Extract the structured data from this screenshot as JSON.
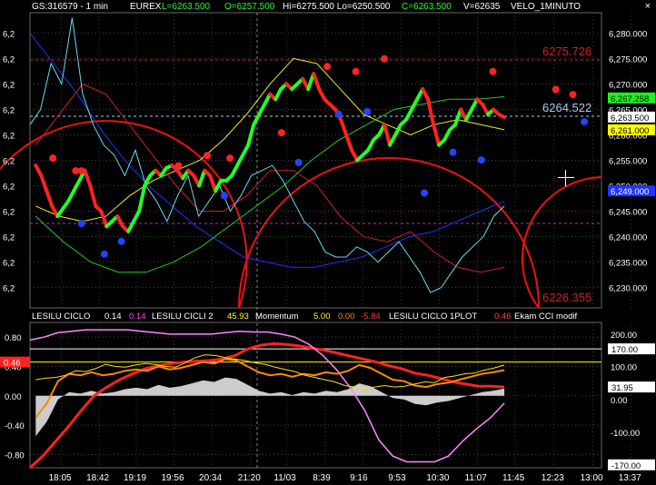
{
  "header": {
    "symbol": "GS:316579 - 1 min",
    "exchange": "EUREX",
    "last": "L=6263.500",
    "open": "O=6257.500",
    "high_low": "Hi=6275.500   Lo=6250.500",
    "close": "C=6263.500",
    "volume": "V=62635",
    "indicator": "VELO_1MINUTO",
    "close_symbol": "×"
  },
  "indicator_header": {
    "i1_name": "LESILU CICLO",
    "i1_v1": "0.14",
    "i1_v2": "0.14",
    "i2_name": "LESILU CICLI 2",
    "i2_v1": "45.93",
    "i3_name": "Momentum",
    "i3_v1": "5.00",
    "i3_v2": "0.00",
    "i3_v3": "-5.84",
    "i4_name": "LESILU CICLO 1PLOT",
    "i4_v1": "0.46",
    "i5_name": "Ekam CCI modif"
  },
  "labels": {
    "level_high": "6275.726",
    "level_mid": "6264.522",
    "level_low": "6226.355"
  },
  "colors": {
    "up": "#22ff22",
    "down": "#ff2222",
    "grid": "#555555",
    "pivot_top": "#ff2222",
    "pivot_bottom": "#2244ff"
  },
  "chart_data": [
    {
      "type": "line",
      "ylim": [
        6226,
        6284
      ],
      "y_axis_right_ticks": [
        "6,280.000",
        "6,275.000",
        "6,270.000",
        "6,265.000",
        "6,260.000",
        "6,255.000",
        "6,250.000",
        "6,245.000",
        "6,240.000",
        "6,235.000",
        "6,230.000"
      ],
      "y_axis_right_tick_values": [
        6280,
        6275,
        6270,
        6265,
        6260,
        6255,
        6250,
        6245,
        6240,
        6235,
        6230
      ],
      "y_axis_left_ticks": [
        "6,2",
        "6,2",
        "6,2",
        "6,2",
        "6,2",
        "6,2",
        "6,2",
        "6,2",
        "6,2",
        "6,2",
        "6,2"
      ],
      "last_value_labels": [
        "6,267.258",
        "6,263.500",
        "6,261.000",
        "6,249.000"
      ],
      "last_value_values": [
        6267.258,
        6263.5,
        6261.0,
        6249.0
      ],
      "last_value_colors": [
        "#22ee22",
        "#ffffff",
        "#ffff00",
        "#2233ff"
      ],
      "horizontal_levels": [
        6275.726,
        6264.522,
        6226.355,
        6243.0
      ],
      "series": [
        {
          "values": [
            6254.0,
            6252.0,
            6249.0,
            6246.0,
            6244.0,
            6245.5,
            6247.0,
            6249.0,
            6251.0,
            6253.0,
            6250.0,
            6246.0,
            6245.0,
            6242.0,
            6243.0,
            6244.0,
            6242.0,
            6241.0,
            6243.0,
            6245.0,
            6250.0,
            6252.0,
            6253.0,
            6252.0,
            6253.5,
            6254.0,
            6253.0,
            6251.5,
            6253.0,
            6252.0,
            6250.0,
            6253.0,
            6252.0,
            6249.0,
            6251.0,
            6251.0,
            6252.0,
            6254.0,
            6256.0,
            6258.0,
            6262.0,
            6264.0,
            6266.0,
            6268.0,
            6267.0,
            6269.0,
            6270.0,
            6269.0,
            6270.0,
            6271.0,
            6269.0,
            6272.0,
            6269.0,
            6267.0,
            6266.0,
            6265.0,
            6263.0,
            6260.0,
            6257.0,
            6255.0,
            6256.0,
            6257.0,
            6259.0,
            6260.0,
            6262.0,
            6258.0,
            6260.0,
            6262.0,
            6263.0,
            6265.0,
            6267.0,
            6269.0,
            6267.0,
            6262.0,
            6258.0,
            6259.0,
            6261.0,
            6262.0,
            6265.0,
            6263.0,
            6265.0,
            6267.0,
            6266.0,
            6264.0,
            6265.0,
            6264.0,
            6263.5
          ]
        },
        {
          "values": [
            6262.0,
            6265.0,
            6274.0,
            6270.0,
            6283.0,
            6268.0,
            6262.0,
            6258.0,
            6256.0,
            6252.0,
            6257.0,
            6250.0,
            6247.0,
            6243.0,
            6248.0,
            6252.0,
            6244.0,
            6247.0,
            6250.0,
            6245.0,
            6248.0,
            6252.0,
            6253.0,
            6254.0,
            6251.0,
            6247.0,
            6243.0,
            6241.0,
            6237.0,
            6236.0,
            6236.0,
            6238.0,
            6237.0,
            6235.0,
            6237.0,
            6239.0,
            6236.0,
            6233.0,
            6229.0,
            6230.0,
            6233.0,
            6236.0,
            6238.0,
            6240.0,
            6244.0,
            6246.0
          ]
        },
        {
          "values": [
            6280.0,
            6274.0,
            6268.0,
            6261.0,
            6255.0,
            6250.0,
            6246.0,
            6242.0,
            6239.0,
            6236.0,
            6235.0,
            6234.0,
            6234.0,
            6235.0,
            6236.0,
            6238.0,
            6240.0,
            6241.0,
            6243.0,
            6245.0,
            6247.0
          ]
        },
        {
          "values": [
            6246.0,
            6244.0,
            6243.0,
            6244.0,
            6248.0,
            6251.0,
            6253.0,
            6255.0,
            6259.0,
            6264.0,
            6270.0,
            6275.0,
            6274.0,
            6269.0,
            6264.0,
            6262.0,
            6260.0,
            6262.0,
            6263.0,
            6262.0,
            6261.0
          ]
        },
        {
          "values": [
            6244.0,
            6239.0,
            6235.0,
            6233.0,
            6233.0,
            6235.0,
            6238.0,
            6242.0,
            6246.0,
            6250.0,
            6255.0,
            6259.0,
            6262.0,
            6265.0,
            6266.0,
            6267.0,
            6267.0,
            6267.5
          ]
        },
        {
          "values": [
            6258.0,
            6264.0,
            6270.0,
            6268.0,
            6262.0,
            6256.0,
            6250.0,
            6245.0,
            6245.0,
            6248.0,
            6253.0,
            6253.0,
            6250.0,
            6244.0,
            6240.0,
            6239.0,
            6241.0,
            6237.0,
            6234.0,
            6233.0,
            6234.0
          ]
        }
      ],
      "pivots_top": [
        [
          0.04,
          6254.0
        ],
        [
          0.08,
          6251.5
        ],
        [
          0.09,
          6251.5
        ],
        [
          0.26,
          6252.5
        ],
        [
          0.31,
          6254.5
        ],
        [
          0.35,
          6254.0
        ],
        [
          0.44,
          6259.0
        ],
        [
          0.52,
          6272.0
        ],
        [
          0.57,
          6271.0
        ],
        [
          0.62,
          6273.5
        ],
        [
          0.81,
          6271.0
        ],
        [
          0.92,
          6267.5
        ],
        [
          0.95,
          6266.5
        ]
      ],
      "pivots_bottom": [
        [
          0.09,
          6244.0
        ],
        [
          0.13,
          6238.0
        ],
        [
          0.16,
          6240.5
        ],
        [
          0.34,
          6249.5
        ],
        [
          0.47,
          6256.0
        ],
        [
          0.54,
          6265.5
        ],
        [
          0.59,
          6266.0
        ],
        [
          0.69,
          6250.0
        ],
        [
          0.74,
          6258.0
        ],
        [
          0.79,
          6256.5
        ],
        [
          0.97,
          6264.0
        ]
      ]
    },
    {
      "type": "line",
      "ylim": [
        -0.98,
        1.0
      ],
      "y_axis_left_ticks": [
        "0.80",
        "0.40",
        "0.00",
        "-0.40",
        "-0.80"
      ],
      "y_axis_left_tick_values": [
        0.8,
        0.4,
        0.0,
        -0.4,
        -0.8
      ],
      "y_axis_right_ticks": [
        "200.00",
        "100.00",
        "0.00",
        "-100.00"
      ],
      "y_axis_right_tick_values": [
        0.84,
        0.4,
        -0.05,
        -0.5
      ],
      "last_value_labels": [
        "0.46",
        "170.00",
        "31.95",
        "-170.00"
      ],
      "last_value_values": [
        0.46,
        0.64,
        0.12,
        -0.94
      ],
      "x_tick_labels": [
        "18:05",
        "18:42",
        "19:19",
        "19:56",
        "20:34",
        "21:20",
        "11/03",
        "8:39",
        "9:16",
        "9:53",
        "10:30",
        "11:07",
        "11:45",
        "12:23",
        "13:00",
        "13:37"
      ],
      "x_tick_fractions": [
        0.055,
        0.121,
        0.186,
        0.252,
        0.318,
        0.386,
        0.449,
        0.517,
        0.582,
        0.649,
        0.716,
        0.783,
        0.849,
        0.917,
        0.985,
        1.052
      ],
      "series": [
        {
          "values": [
            0.22,
            0.24,
            0.25,
            0.28,
            0.34,
            0.33,
            0.37,
            0.43,
            0.4,
            0.39,
            0.42,
            0.44,
            0.43,
            0.4,
            0.39,
            0.45,
            0.52,
            0.56,
            0.55,
            0.52,
            0.5,
            0.48,
            0.45,
            0.43,
            0.39,
            0.36,
            0.33,
            0.28,
            0.25,
            0.22,
            0.19,
            0.14,
            0.12,
            0.1,
            0.12,
            0.14,
            0.12,
            0.13,
            0.16,
            0.19,
            0.18,
            0.25,
            0.27,
            0.3,
            0.31,
            0.35,
            0.38,
            0.42
          ]
        },
        {
          "values": [
            -0.98,
            -0.82,
            -0.62,
            -0.42,
            -0.2,
            0.0,
            0.12,
            0.22,
            0.3,
            0.37,
            0.41,
            0.44,
            0.46,
            0.47,
            0.48,
            0.5,
            0.55,
            0.64,
            0.69,
            0.71,
            0.7,
            0.68,
            0.65,
            0.62,
            0.58,
            0.54,
            0.5,
            0.46,
            0.41,
            0.37,
            0.31,
            0.28,
            0.24,
            0.19,
            0.16,
            0.13,
            0.13,
            0.12
          ]
        },
        {
          "values": [
            0.76,
            0.8,
            0.86,
            0.88,
            0.9,
            0.9,
            0.9,
            0.9,
            0.88,
            0.86,
            0.84,
            0.84,
            0.84,
            0.84,
            0.86,
            0.88,
            0.87,
            0.87,
            0.84,
            0.8,
            0.7,
            0.55,
            0.35,
            0.1,
            -0.2,
            -0.6,
            -0.82,
            -0.9,
            -0.9,
            -0.9,
            -0.82,
            -0.62,
            -0.45,
            -0.3,
            -0.1
          ]
        },
        {
          "values": [
            -0.3,
            -0.1,
            0.2,
            0.3,
            0.28,
            0.32,
            0.28,
            0.3,
            0.34,
            0.36,
            0.34,
            0.4,
            0.36,
            0.38,
            0.42,
            0.46,
            0.44,
            0.5,
            0.48,
            0.4,
            0.32,
            0.28,
            0.3,
            0.26,
            0.3,
            0.28,
            0.32,
            0.3,
            0.34,
            0.42,
            0.38,
            0.3,
            0.22,
            0.2,
            0.14,
            0.12,
            0.16,
            0.18,
            0.22,
            0.26,
            0.3,
            0.32,
            0.35
          ]
        }
      ]
    }
  ]
}
